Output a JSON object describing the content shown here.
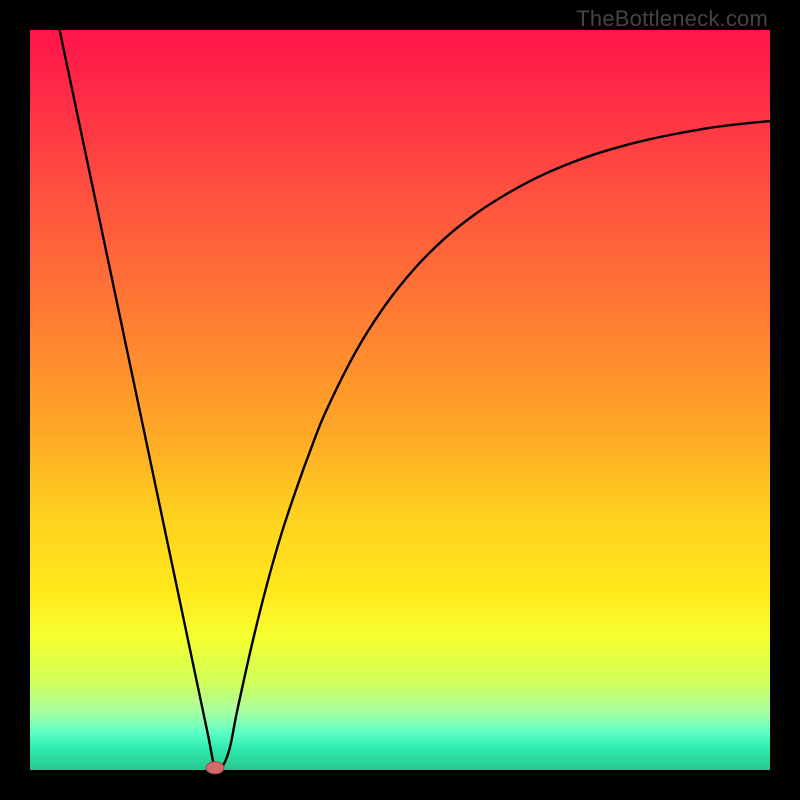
{
  "watermark": "TheBottleneck.com",
  "chart_data": {
    "type": "line",
    "title": "",
    "xlabel": "",
    "ylabel": "",
    "xlim": [
      0,
      100
    ],
    "ylim": [
      0,
      100
    ],
    "x": [
      4,
      6,
      8,
      10,
      12,
      14,
      16,
      18,
      20,
      22,
      24,
      25,
      26,
      27,
      28,
      30,
      32,
      34,
      36,
      38,
      40,
      44,
      48,
      52,
      56,
      60,
      64,
      68,
      72,
      76,
      80,
      84,
      88,
      92,
      96,
      100
    ],
    "y": [
      100,
      90.5,
      81,
      71.5,
      62,
      52.5,
      43,
      33.5,
      24,
      14.5,
      5,
      0.3,
      0.5,
      3,
      8,
      17,
      25,
      32,
      38,
      43.5,
      48.5,
      56.5,
      62.8,
      67.8,
      71.8,
      75,
      77.6,
      79.8,
      81.6,
      83.1,
      84.3,
      85.3,
      86.1,
      86.8,
      87.3,
      87.7
    ],
    "marker": {
      "x": 25,
      "y": 0.3
    },
    "background_gradient": {
      "top": "#ff144a",
      "mid": "#ffd21f",
      "bottom": "#28c48f"
    }
  }
}
